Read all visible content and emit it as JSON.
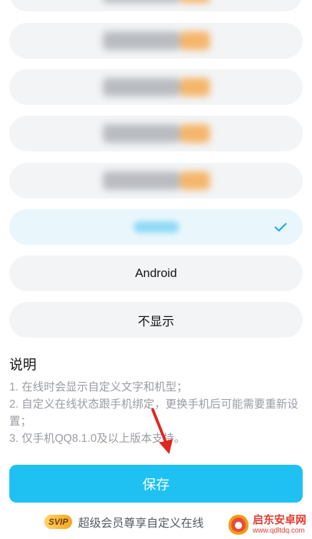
{
  "options": [
    {
      "type": "blurred"
    },
    {
      "type": "blurred"
    },
    {
      "type": "blurred"
    },
    {
      "type": "blurred"
    },
    {
      "type": "blurred"
    },
    {
      "type": "blurred-selected",
      "selected": true
    },
    {
      "type": "text",
      "label": "Android"
    },
    {
      "type": "text",
      "label": "不显示"
    }
  ],
  "notes": {
    "title": "说明",
    "lines": [
      "1. 在线时会显示自定义文字和机型；",
      "2. 自定义在线状态跟手机绑定，更换手机后可能需要重新设置；",
      "3. 仅手机QQ8.1.0及以上版本支持。"
    ]
  },
  "save_label": "保存",
  "promo": {
    "badge": "SVIP",
    "text": "超级会员尊享自定义在线"
  },
  "watermark": {
    "title": "启东安卓网",
    "url": "www.qdltdq.com"
  },
  "colors": {
    "accent": "#1fc1f3",
    "option_bg": "#f3f4f6",
    "selected_bg": "#e9f7fd",
    "check": "#1fa9e6"
  }
}
